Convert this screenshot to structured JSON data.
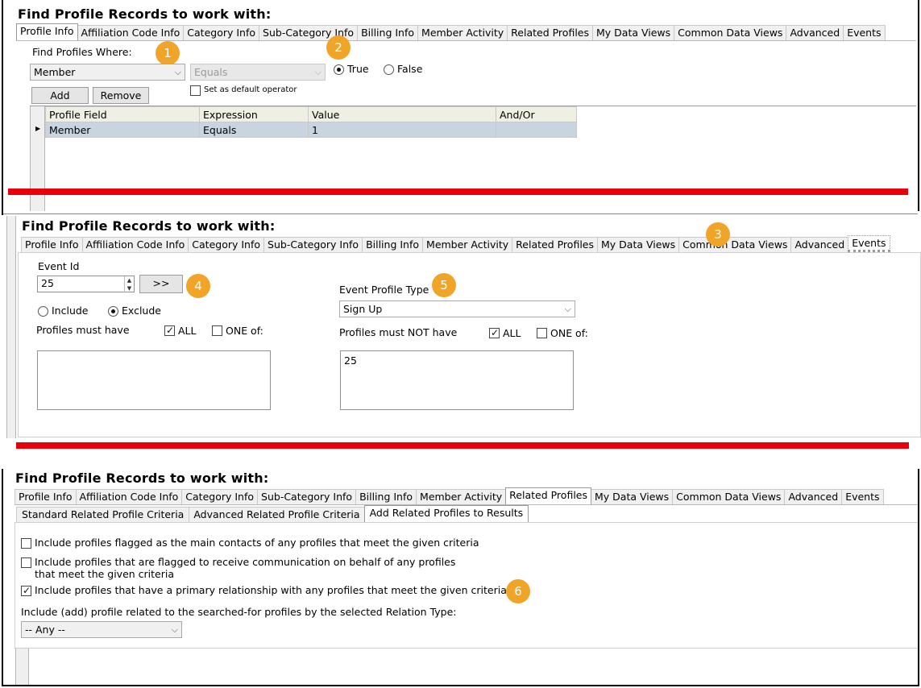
{
  "heading": "Find Profile Records to work with:",
  "tabs": [
    "Profile Info",
    "Affiliation Code Info",
    "Category Info",
    "Sub-Category Info",
    "Billing Info",
    "Member Activity",
    "Related Profiles",
    "My Data Views",
    "Common Data Views",
    "Advanced",
    "Events"
  ],
  "panel1": {
    "find_where_label": "Find Profiles Where:",
    "field_select": "Member",
    "operator_select": "Equals",
    "true_label": "True",
    "false_label": "False",
    "default_operator_label": "Set as default operator",
    "add_button": "Add",
    "remove_button": "Remove",
    "grid_headers": [
      "Profile Field",
      "Expression",
      "Value",
      "And/Or"
    ],
    "grid_rows": [
      [
        "Member",
        "Equals",
        "1",
        ""
      ]
    ],
    "badges": [
      "1",
      "2"
    ]
  },
  "panel2": {
    "event_id_label": "Event Id",
    "event_id_value": "25",
    "arrow_button": ">>",
    "include_label": "Include",
    "exclude_label": "Exclude",
    "must_have_label": "Profiles must have",
    "all_label": "ALL",
    "one_of_label": "ONE of:",
    "event_profile_type_label": "Event Profile Type",
    "event_profile_type_value": "Sign Up",
    "must_not_have_label": "Profiles must NOT have",
    "must_not_have_value": "25",
    "badges": [
      "3",
      "4",
      "5"
    ]
  },
  "panel3": {
    "subtabs": [
      "Standard Related Profile Criteria",
      "Advanced Related Profile Criteria",
      "Add Related Profiles to Results"
    ],
    "opt1": "Include profiles flagged as the main contacts of any profiles that meet the given criteria",
    "opt2_line1": "Include profiles that are flagged to receive communication on behalf of any profiles",
    "opt2_line2": "that meet the given criteria",
    "opt3": "Include profiles that have a primary relationship with any profiles that meet the given criteria",
    "relation_label": "Include (add) profile related to the searched-for profiles by the selected Relation Type:",
    "relation_value": "-- Any --",
    "badges": [
      "6"
    ]
  },
  "colors": {
    "badge": "#f0a428",
    "divider": "#e8000b",
    "selected_row": "#c8d4e0"
  }
}
